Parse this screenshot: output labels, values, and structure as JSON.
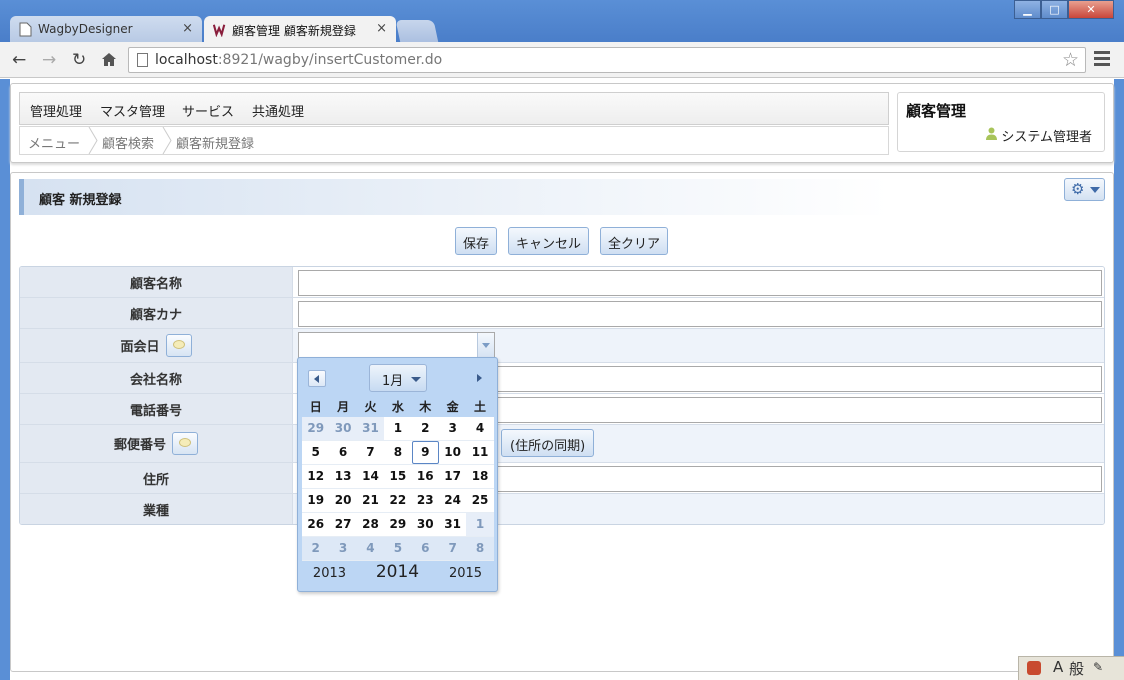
{
  "browser": {
    "tabs": [
      {
        "label": "WagbyDesigner",
        "close": "×"
      },
      {
        "label": "顧客管理 顧客新規登録",
        "close": "×"
      }
    ],
    "url_host": "localhost",
    "url_rest": ":8921/wagby/insertCustomer.do",
    "window_controls": {
      "minimize": "▁",
      "maximize": "□",
      "close": "✕"
    }
  },
  "header": {
    "menu": [
      "管理処理",
      "マスタ管理",
      "サービス",
      "共通処理"
    ],
    "breadcrumb": [
      "メニュー",
      "顧客検索",
      "顧客新規登録"
    ],
    "app_title": "顧客管理",
    "user": "システム管理者"
  },
  "section": {
    "title": "顧客 新規登録"
  },
  "actions": {
    "save": "保存",
    "cancel": "キャンセル",
    "clear_all": "全クリア"
  },
  "form": {
    "fields": {
      "customer_name": "顧客名称",
      "customer_kana": "顧客カナ",
      "meeting_date": "面会日",
      "company_name": "会社名称",
      "phone": "電話番号",
      "postal_code": "郵便番号",
      "address": "住所",
      "industry": "業種"
    },
    "sync_address_button": "(住所の同期)"
  },
  "calendar": {
    "month": "1月",
    "weekdays": [
      "日",
      "月",
      "火",
      "水",
      "木",
      "金",
      "土"
    ],
    "weeks": [
      [
        "29",
        "30",
        "31",
        "1",
        "2",
        "3",
        "4"
      ],
      [
        "5",
        "6",
        "7",
        "8",
        "9",
        "10",
        "11"
      ],
      [
        "12",
        "13",
        "14",
        "15",
        "16",
        "17",
        "18"
      ],
      [
        "19",
        "20",
        "21",
        "22",
        "23",
        "24",
        "25"
      ],
      [
        "26",
        "27",
        "28",
        "29",
        "30",
        "31",
        "1"
      ],
      [
        "2",
        "3",
        "4",
        "5",
        "6",
        "7",
        "8"
      ]
    ],
    "today": "9",
    "years": {
      "prev": "2013",
      "current": "2014",
      "next": "2015"
    }
  },
  "taskbar": {
    "ime_mode": "A",
    "ime_kanji": "般"
  },
  "colors": {
    "chrome_blue": "#5a8fd6",
    "accent": "#8fb0d8",
    "label_bg": "#e3e9f2"
  }
}
